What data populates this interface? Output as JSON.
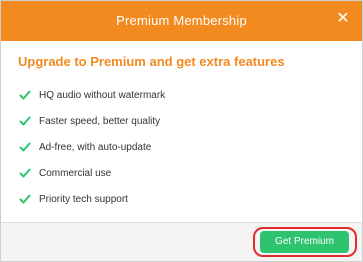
{
  "dialog": {
    "title": "Premium Membership",
    "headline": "Upgrade to Premium and get extra features",
    "features": [
      "HQ audio without watermark",
      "Faster speed, better quality",
      "Ad-free, with auto-update",
      "Commercial use",
      "Priority tech support"
    ],
    "cta_label": "Get Premium"
  },
  "colors": {
    "accent": "#f28a1f",
    "check": "#2ec36f",
    "cta": "#2ec36f",
    "highlight_ring": "#e02c2c"
  },
  "icons": {
    "close": "close-icon",
    "check": "check-icon"
  }
}
